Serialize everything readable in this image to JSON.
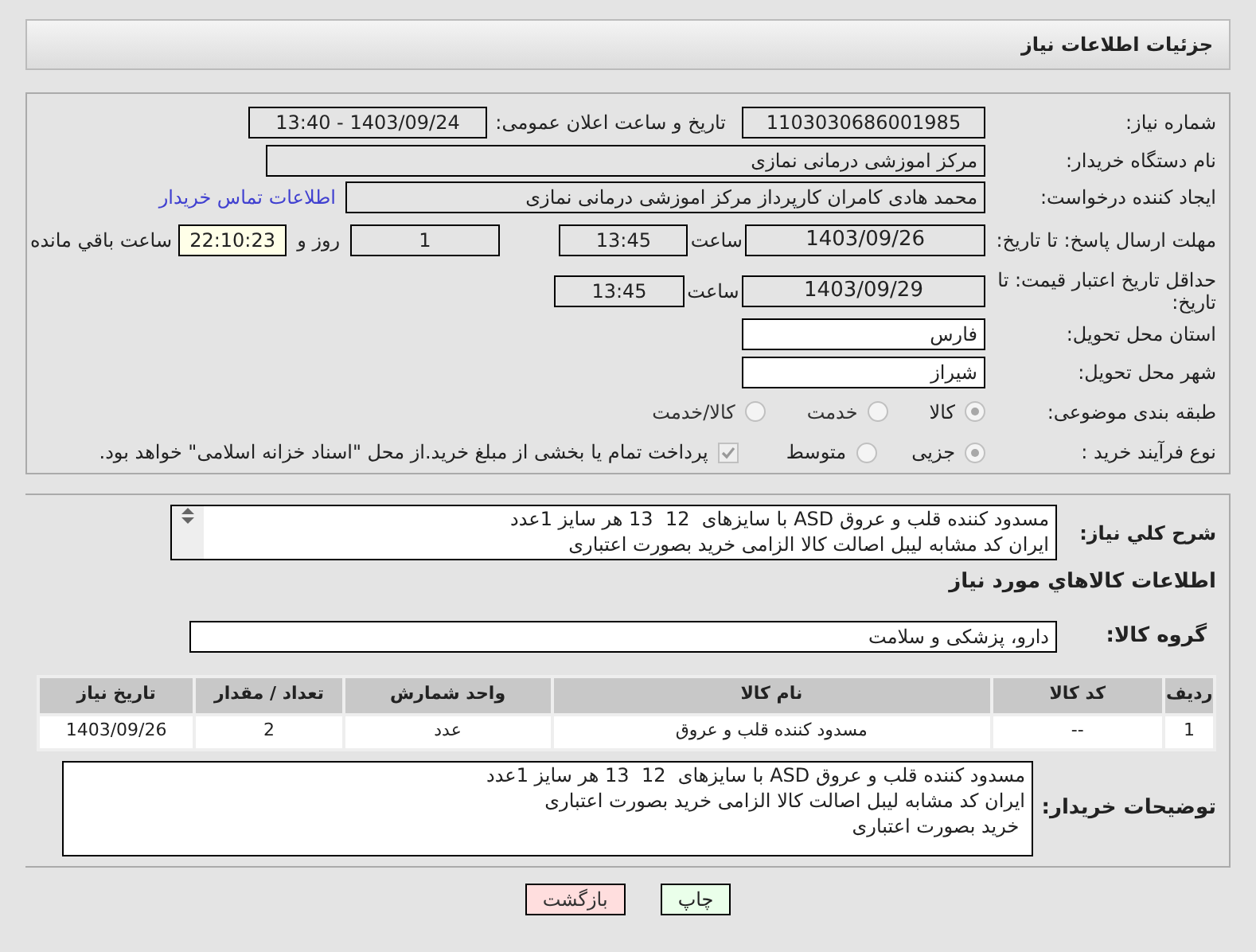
{
  "page_title": "جزئیات اطلاعات نیاز",
  "need_number": {
    "label": "شماره نیاز:",
    "value": "1103030686001985"
  },
  "announce": {
    "label": "تاریخ و ساعت اعلان عمومی:",
    "value": "1403/09/24 - 13:40"
  },
  "buyer_org": {
    "label": "نام دستگاه خریدار:",
    "value": "مرکز اموزشی درمانی نمازی"
  },
  "requester": {
    "label": "ایجاد کننده درخواست:",
    "value": "محمد هادی کامران کارپرداز مرکز اموزشی درمانی نمازی",
    "link": "اطلاعات تماس خریدار"
  },
  "reply_deadline": {
    "label": "مهلت ارسال پاسخ: تا تاریخ:",
    "date": "1403/09/26",
    "time_label": "ساعت",
    "time": "13:45",
    "days": "1",
    "days_label": "روز و",
    "remaining": "22:10:23",
    "remaining_label": "ساعت باقي مانده"
  },
  "price_validity": {
    "label": "حداقل تاریخ اعتبار قیمت: تا تاریخ:",
    "date": "1403/09/29",
    "time_label": "ساعت",
    "time": "13:45"
  },
  "province": {
    "label": "استان محل تحویل:",
    "value": "فارس"
  },
  "city": {
    "label": "شهر محل تحویل:",
    "value": "شیراز"
  },
  "category": {
    "label": "طبقه بندی موضوعی:",
    "options": [
      {
        "label": "کالا",
        "selected": true
      },
      {
        "label": "خدمت",
        "selected": false
      },
      {
        "label": "کالا/خدمت",
        "selected": false
      }
    ]
  },
  "purchase_type": {
    "label": "نوع فرآیند خرید :",
    "options": [
      {
        "label": "جزیی",
        "selected": true
      },
      {
        "label": "متوسط",
        "selected": false
      }
    ],
    "payment": {
      "checked": true,
      "label": "پرداخت تمام یا بخشی از مبلغ خرید.از محل \"اسناد خزانه اسلامی\" خواهد بود."
    }
  },
  "description": {
    "label": "شرح کلي نياز:",
    "lines": [
      "مسدود کننده قلب و عروق ASD با سایزهای  12  13 هر سایز 1عدد",
      "ایران کد مشابه لیبل اصالت کالا الزامی خرید بصورت اعتباری"
    ]
  },
  "goods_heading": "اطلاعات کالاهاي مورد نياز",
  "goods_group": {
    "label": "گروه کالا:",
    "value": "دارو، پزشکی و سلامت"
  },
  "table": {
    "columns": [
      "ردیف",
      "کد کالا",
      "نام کالا",
      "واحد شمارش",
      "تعداد / مقدار",
      "تاریخ نیاز"
    ],
    "rows": [
      [
        "1",
        "--",
        "مسدود کننده قلب و عروق",
        "عدد",
        "2",
        "1403/09/26"
      ]
    ]
  },
  "buyer_notes": {
    "label": "توضیحات خریدار:",
    "lines": [
      "مسدود کننده قلب و عروق ASD با سایزهای  12  13 هر سایز 1عدد",
      "ایران کد مشابه لیبل اصالت کالا الزامی خرید بصورت اعتباری",
      " خرید بصورت اعتباری"
    ]
  },
  "buttons": [
    {
      "kind": "print",
      "label": "چاپ"
    },
    {
      "kind": "back",
      "label": "بازگشت"
    }
  ]
}
